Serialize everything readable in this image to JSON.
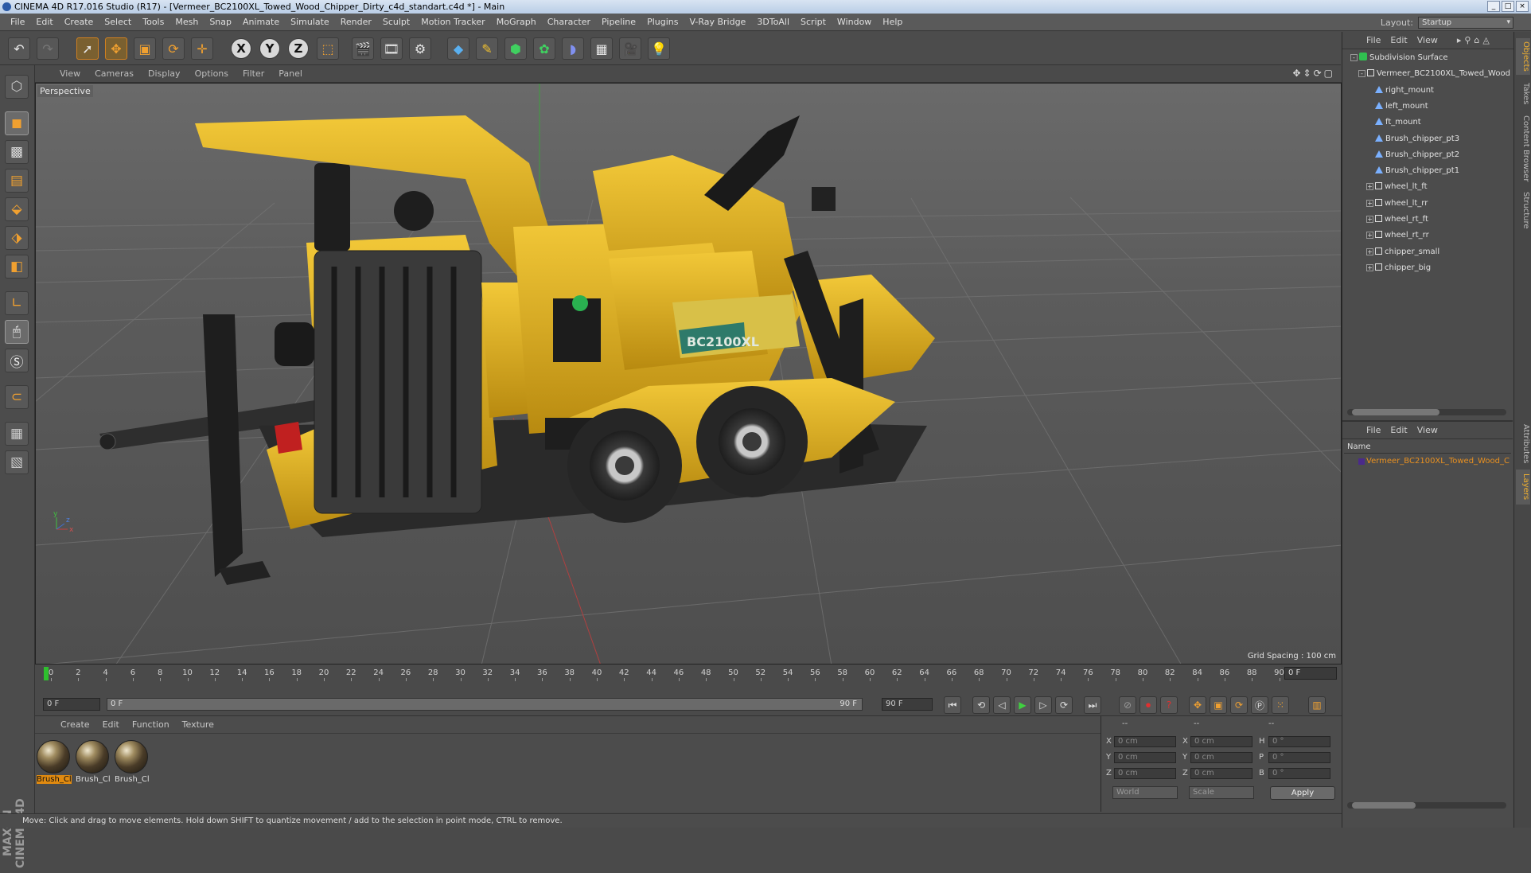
{
  "window": {
    "title": "CINEMA 4D R17.016 Studio (R17) - [Vermeer_BC2100XL_Towed_Wood_Chipper_Dirty_c4d_standart.c4d *] - Main"
  },
  "menubar": {
    "items": [
      "File",
      "Edit",
      "Create",
      "Select",
      "Tools",
      "Mesh",
      "Snap",
      "Animate",
      "Simulate",
      "Render",
      "Sculpt",
      "Motion Tracker",
      "MoGraph",
      "Character",
      "Pipeline",
      "Plugins",
      "V-Ray Bridge",
      "3DToAll",
      "Script",
      "Window",
      "Help"
    ],
    "layout_label": "Layout:",
    "layout_value": "Startup"
  },
  "toolbar": {
    "axis_x": "X",
    "axis_y": "Y",
    "axis_z": "Z"
  },
  "viewport": {
    "menu": [
      "View",
      "Cameras",
      "Display",
      "Options",
      "Filter",
      "Panel"
    ],
    "camera_label": "Perspective",
    "grid_spacing": "Grid Spacing : 100 cm",
    "decal_text": "BC2100XL",
    "axis_labels": {
      "x": "x",
      "y": "y",
      "z": "z"
    }
  },
  "timeline": {
    "ticks": [
      "0",
      "2",
      "4",
      "6",
      "8",
      "10",
      "12",
      "14",
      "16",
      "18",
      "20",
      "22",
      "24",
      "26",
      "28",
      "30",
      "32",
      "34",
      "36",
      "38",
      "40",
      "42",
      "44",
      "46",
      "48",
      "50",
      "52",
      "54",
      "56",
      "58",
      "60",
      "62",
      "64",
      "66",
      "68",
      "70",
      "72",
      "74",
      "76",
      "78",
      "80",
      "82",
      "84",
      "86",
      "88",
      "90"
    ],
    "current_frame": "0 F",
    "start_field": "0 F",
    "range_start": "0 F",
    "range_end": "90 F",
    "end_field": "90 F"
  },
  "materials": {
    "menu": [
      "Create",
      "Edit",
      "Function",
      "Texture"
    ],
    "items": [
      {
        "name": "Brush_Cl",
        "selected": true
      },
      {
        "name": "Brush_Cl",
        "selected": false
      },
      {
        "name": "Brush_Cl",
        "selected": false
      }
    ]
  },
  "coordinates": {
    "header": [
      "--",
      "--",
      "--"
    ],
    "rows": [
      {
        "a": "X",
        "av": "0 cm",
        "b": "X",
        "bv": "0 cm",
        "c": "H",
        "cv": "0 °"
      },
      {
        "a": "Y",
        "av": "0 cm",
        "b": "Y",
        "bv": "0 cm",
        "c": "P",
        "cv": "0 °"
      },
      {
        "a": "Z",
        "av": "0 cm",
        "b": "Z",
        "bv": "0 cm",
        "c": "B",
        "cv": "0 °"
      }
    ],
    "mode": "World",
    "scale": "Scale",
    "apply": "Apply"
  },
  "status": {
    "text": "Move: Click and drag to move elements. Hold down SHIFT to quantize movement / add to the selection in point mode, CTRL to remove."
  },
  "objects_panel": {
    "menu": [
      "File",
      "Edit",
      "View"
    ],
    "tree": [
      {
        "name": "Subdivision Surface",
        "depth": 0,
        "kind": "subdiv",
        "expander": "-"
      },
      {
        "name": "Vermeer_BC2100XL_Towed_Wood",
        "depth": 1,
        "kind": "null",
        "expander": "-"
      },
      {
        "name": "right_mount",
        "depth": 2,
        "kind": "joint",
        "expander": ""
      },
      {
        "name": "left_mount",
        "depth": 2,
        "kind": "joint",
        "expander": ""
      },
      {
        "name": "ft_mount",
        "depth": 2,
        "kind": "joint",
        "expander": ""
      },
      {
        "name": "Brush_chipper_pt3",
        "depth": 2,
        "kind": "joint",
        "expander": ""
      },
      {
        "name": "Brush_chipper_pt2",
        "depth": 2,
        "kind": "joint",
        "expander": ""
      },
      {
        "name": "Brush_chipper_pt1",
        "depth": 2,
        "kind": "joint",
        "expander": ""
      },
      {
        "name": "wheel_lt_ft",
        "depth": 2,
        "kind": "null",
        "expander": "+"
      },
      {
        "name": "wheel_lt_rr",
        "depth": 2,
        "kind": "null",
        "expander": "+"
      },
      {
        "name": "wheel_rt_ft",
        "depth": 2,
        "kind": "null",
        "expander": "+"
      },
      {
        "name": "wheel_rt_rr",
        "depth": 2,
        "kind": "null",
        "expander": "+"
      },
      {
        "name": "chipper_small",
        "depth": 2,
        "kind": "null",
        "expander": "+"
      },
      {
        "name": "chipper_big",
        "depth": 2,
        "kind": "null",
        "expander": "+"
      }
    ]
  },
  "layers_panel": {
    "menu": [
      "File",
      "Edit",
      "View"
    ],
    "header": "Name",
    "row": "Vermeer_BC2100XL_Towed_Wood_C"
  },
  "side_tabs": {
    "top": [
      "Objects",
      "Takes",
      "Content Browser",
      "Structure"
    ],
    "bottom": [
      "Attributes",
      "Layers"
    ]
  },
  "colors": {
    "accent": "#e08a10",
    "machine_yellow": "#e8b820",
    "viewport_bg": "#5e5e5e"
  }
}
